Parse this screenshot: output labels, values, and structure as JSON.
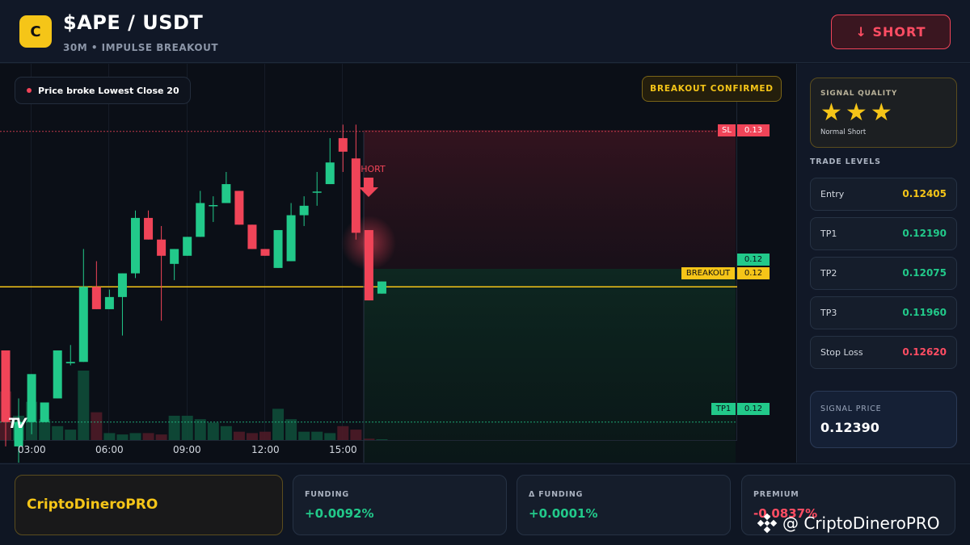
{
  "header": {
    "logo_letter": "C",
    "pair": "$APE / USDT",
    "subtitle": "30M • IMPULSE BREAKOUT",
    "short_button": "↓ SHORT"
  },
  "chart": {
    "info_pill": "Price broke Lowest Close 20",
    "confirm_badge": "BREAKOUT CONFIRMED",
    "short_marker": "SHORT",
    "tv_logo": "TV",
    "tags": {
      "sl_label": "SL",
      "sl_value": "0.13",
      "entry_value": "0.12",
      "breakout_label": "BREAKOUT",
      "breakout_value": "0.12",
      "tp1_label": "TP1",
      "tp1_value": "0.12"
    },
    "time_labels": [
      "03:00",
      "06:00",
      "09:00",
      "12:00",
      "15:00"
    ]
  },
  "chart_data": {
    "type": "candlestick",
    "title": "",
    "interval": "30M",
    "x_ticks": [
      "03:00",
      "06:00",
      "09:00",
      "12:00",
      "15:00"
    ],
    "price_levels": {
      "stop_loss": 0.1262,
      "entry": 0.12405,
      "breakout": 0.1239,
      "tp1": 0.1219
    },
    "candles": [
      {
        "o": 0.12296,
        "c": 0.1219,
        "h": 0.12296,
        "l": 0.12154
      },
      {
        "o": 0.12154,
        "c": 0.1219,
        "h": 0.12225,
        "l": 0.12116
      },
      {
        "o": 0.1219,
        "c": 0.12261,
        "h": 0.12261,
        "l": 0.12172
      },
      {
        "o": 0.1219,
        "c": 0.12219,
        "h": 0.12219,
        "l": 0.1219
      },
      {
        "o": 0.12225,
        "c": 0.12296,
        "h": 0.12296,
        "l": 0.12225
      },
      {
        "o": 0.12277,
        "c": 0.12279,
        "h": 0.12304,
        "l": 0.12274
      },
      {
        "o": 0.12279,
        "c": 0.1239,
        "h": 0.12446,
        "l": 0.12279
      },
      {
        "o": 0.1239,
        "c": 0.12357,
        "h": 0.12428,
        "l": 0.12357
      },
      {
        "o": 0.12357,
        "c": 0.12375,
        "h": 0.12386,
        "l": 0.12357
      },
      {
        "o": 0.12375,
        "c": 0.1241,
        "h": 0.1241,
        "l": 0.12318
      },
      {
        "o": 0.1241,
        "c": 0.12492,
        "h": 0.12503,
        "l": 0.12403
      },
      {
        "o": 0.12492,
        "c": 0.1246,
        "h": 0.12503,
        "l": 0.1246
      },
      {
        "o": 0.1246,
        "c": 0.12436,
        "h": 0.1248,
        "l": 0.1234
      },
      {
        "o": 0.12424,
        "c": 0.12446,
        "h": 0.12446,
        "l": 0.124
      },
      {
        "o": 0.12436,
        "c": 0.12464,
        "h": 0.12464,
        "l": 0.12436
      },
      {
        "o": 0.12464,
        "c": 0.12514,
        "h": 0.12532,
        "l": 0.12464
      },
      {
        "o": 0.1251,
        "c": 0.12511,
        "h": 0.12524,
        "l": 0.12486
      },
      {
        "o": 0.12514,
        "c": 0.12542,
        "h": 0.1256,
        "l": 0.12514
      },
      {
        "o": 0.12532,
        "c": 0.12482,
        "h": 0.12532,
        "l": 0.12482
      },
      {
        "o": 0.12482,
        "c": 0.12446,
        "h": 0.12482,
        "l": 0.12446
      },
      {
        "o": 0.12446,
        "c": 0.12436,
        "h": 0.12446,
        "l": 0.12436
      },
      {
        "o": 0.12418,
        "c": 0.12474,
        "h": 0.12474,
        "l": 0.12418
      },
      {
        "o": 0.12428,
        "c": 0.12496,
        "h": 0.12514,
        "l": 0.12428
      },
      {
        "o": 0.12496,
        "c": 0.1251,
        "h": 0.12524,
        "l": 0.1248
      },
      {
        "o": 0.1253,
        "c": 0.12531,
        "h": 0.1256,
        "l": 0.1251
      },
      {
        "o": 0.12542,
        "c": 0.12574,
        "h": 0.1261,
        "l": 0.12542
      },
      {
        "o": 0.1261,
        "c": 0.1259,
        "h": 0.1263,
        "l": 0.1256
      },
      {
        "o": 0.1258,
        "c": 0.1247,
        "h": 0.1263,
        "l": 0.1246
      },
      {
        "o": 0.12474,
        "c": 0.1237,
        "h": 0.12474,
        "l": 0.1237
      },
      {
        "o": 0.1238,
        "c": 0.12398,
        "h": 0.12398,
        "l": 0.1238
      }
    ],
    "volumes": [
      0.7,
      0.35,
      0.55,
      0.3,
      0.2,
      0.15,
      1.0,
      0.4,
      0.1,
      0.08,
      0.1,
      0.1,
      0.08,
      0.35,
      0.35,
      0.3,
      0.25,
      0.2,
      0.12,
      0.1,
      0.12,
      0.45,
      0.3,
      0.12,
      0.12,
      0.1,
      0.2,
      0.15,
      0.02,
      0.01
    ],
    "ylim": [
      0.1213,
      0.1272
    ]
  },
  "panel": {
    "quality_title": "SIGNAL QUALITY",
    "stars": [
      "★",
      "★",
      "★"
    ],
    "quality_sub": "Normal Short",
    "levels_title": "TRADE LEVELS",
    "levels": [
      {
        "label": "Entry",
        "value": "0.12405",
        "color": "#f5c518"
      },
      {
        "label": "TP1",
        "value": "0.12190",
        "color": "#22c98a"
      },
      {
        "label": "TP2",
        "value": "0.12075",
        "color": "#22c98a"
      },
      {
        "label": "TP3",
        "value": "0.11960",
        "color": "#22c98a"
      },
      {
        "label": "Stop Loss",
        "value": "0.12620",
        "color": "#ff4d63"
      }
    ],
    "signal_label": "SIGNAL PRICE",
    "signal_value": "0.12390"
  },
  "footer": {
    "brand": "CriptoDineroPRO",
    "stats": [
      {
        "label": "FUNDING",
        "value": "+0.0092%",
        "color": "#22c98a"
      },
      {
        "label": "Δ FUNDING",
        "value": "+0.0001%",
        "color": "#22c98a"
      },
      {
        "label": "PREMIUM",
        "value": "-0.0837%",
        "color": "#ff4d63"
      }
    ],
    "watermark": "@ CriptoDineroPRO"
  },
  "colors": {
    "up": "#22c98a",
    "down": "#f04458",
    "accent": "#f5c518",
    "bg": "#0b0f17"
  }
}
